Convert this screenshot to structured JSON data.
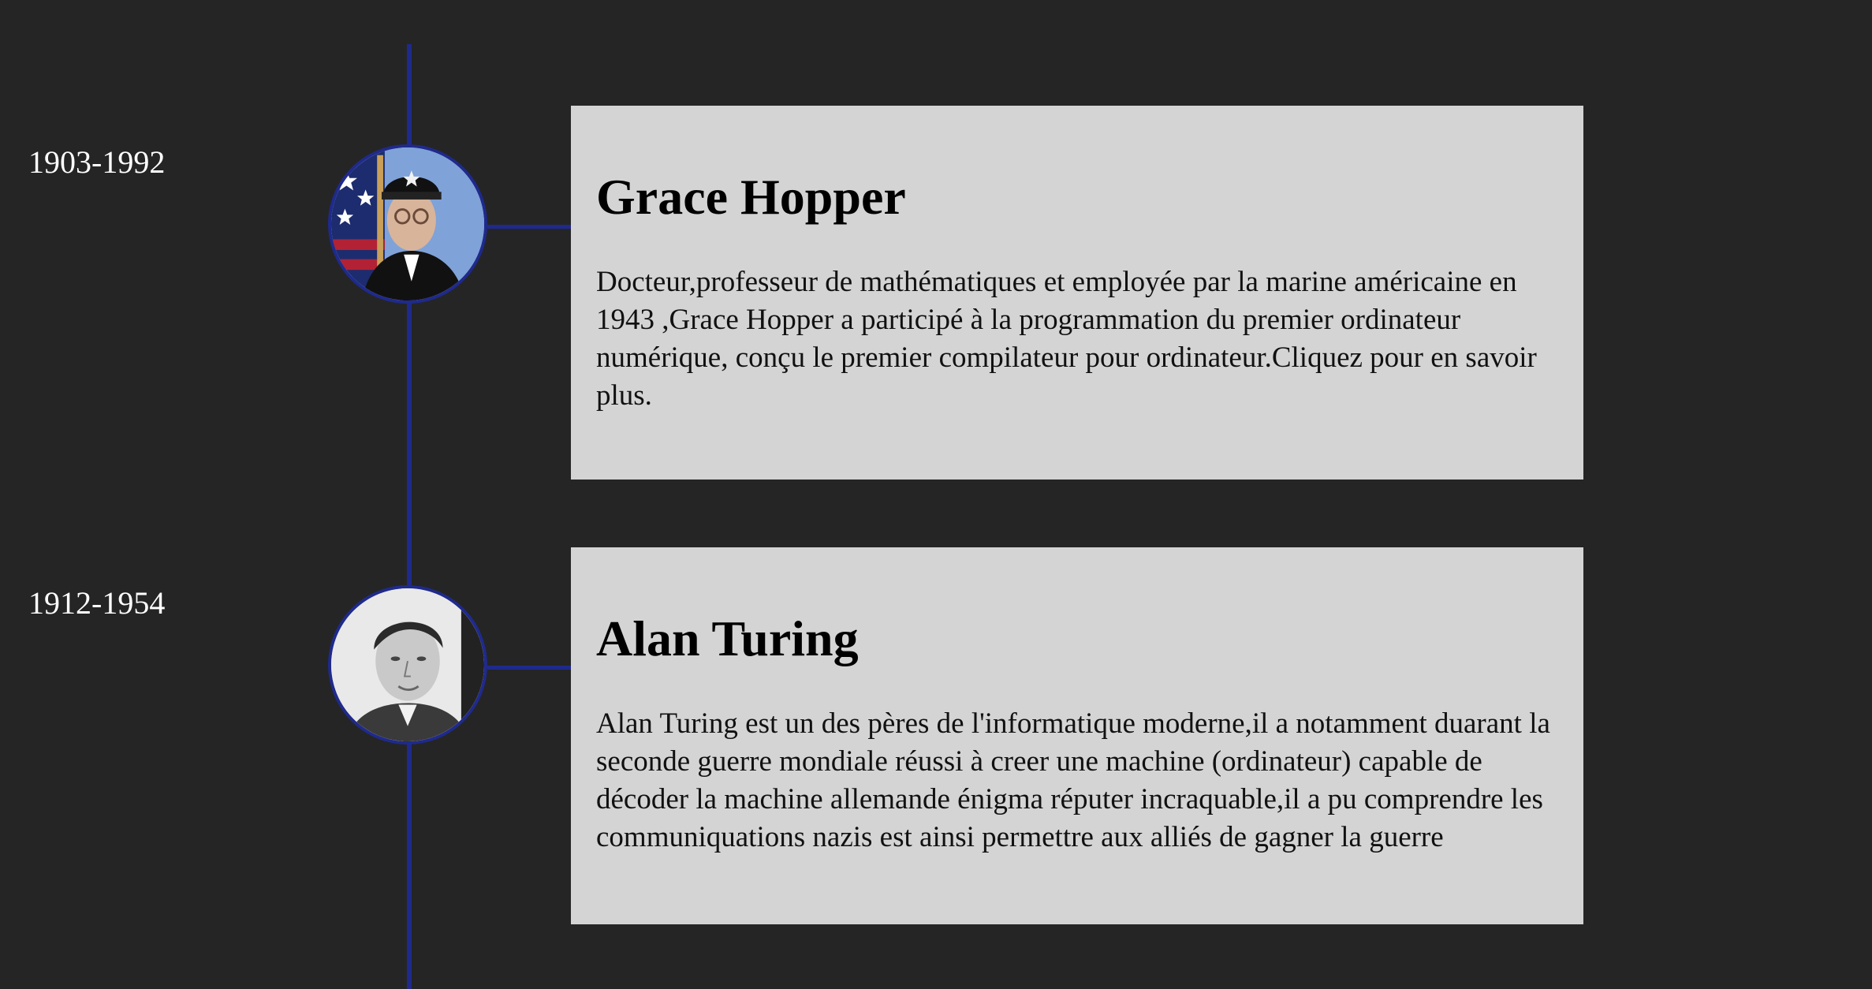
{
  "timeline": {
    "entries": [
      {
        "years": "1903-1992",
        "name": "Grace Hopper",
        "description": "Docteur,professeur de mathématiques et employée par la marine américaine en 1943 ,Grace Hopper a participé à la programmation du premier ordinateur numérique, conçu le premier compilateur pour ordinateur.Cliquez pour en savoir plus.",
        "portrait_alt": "Portrait de Grace Hopper"
      },
      {
        "years": "1912-1954",
        "name": "Alan Turing",
        "description": "Alan Turing est un des pères de l'informatique moderne,il a notamment duarant la seconde guerre mondiale réussi à creer une machine (ordinateur) capable de décoder la machine allemande énigma réputer incraquable,il a pu comprendre les communiquations nazis est ainsi permettre aux alliés de gagner la guerre",
        "portrait_alt": "Portrait d'Alan Turing"
      }
    ]
  },
  "colors": {
    "background": "#252525",
    "timeline": "#1f2a8c",
    "card": "#d4d4d4",
    "text_light": "#ffffff",
    "text_dark": "#000000"
  }
}
